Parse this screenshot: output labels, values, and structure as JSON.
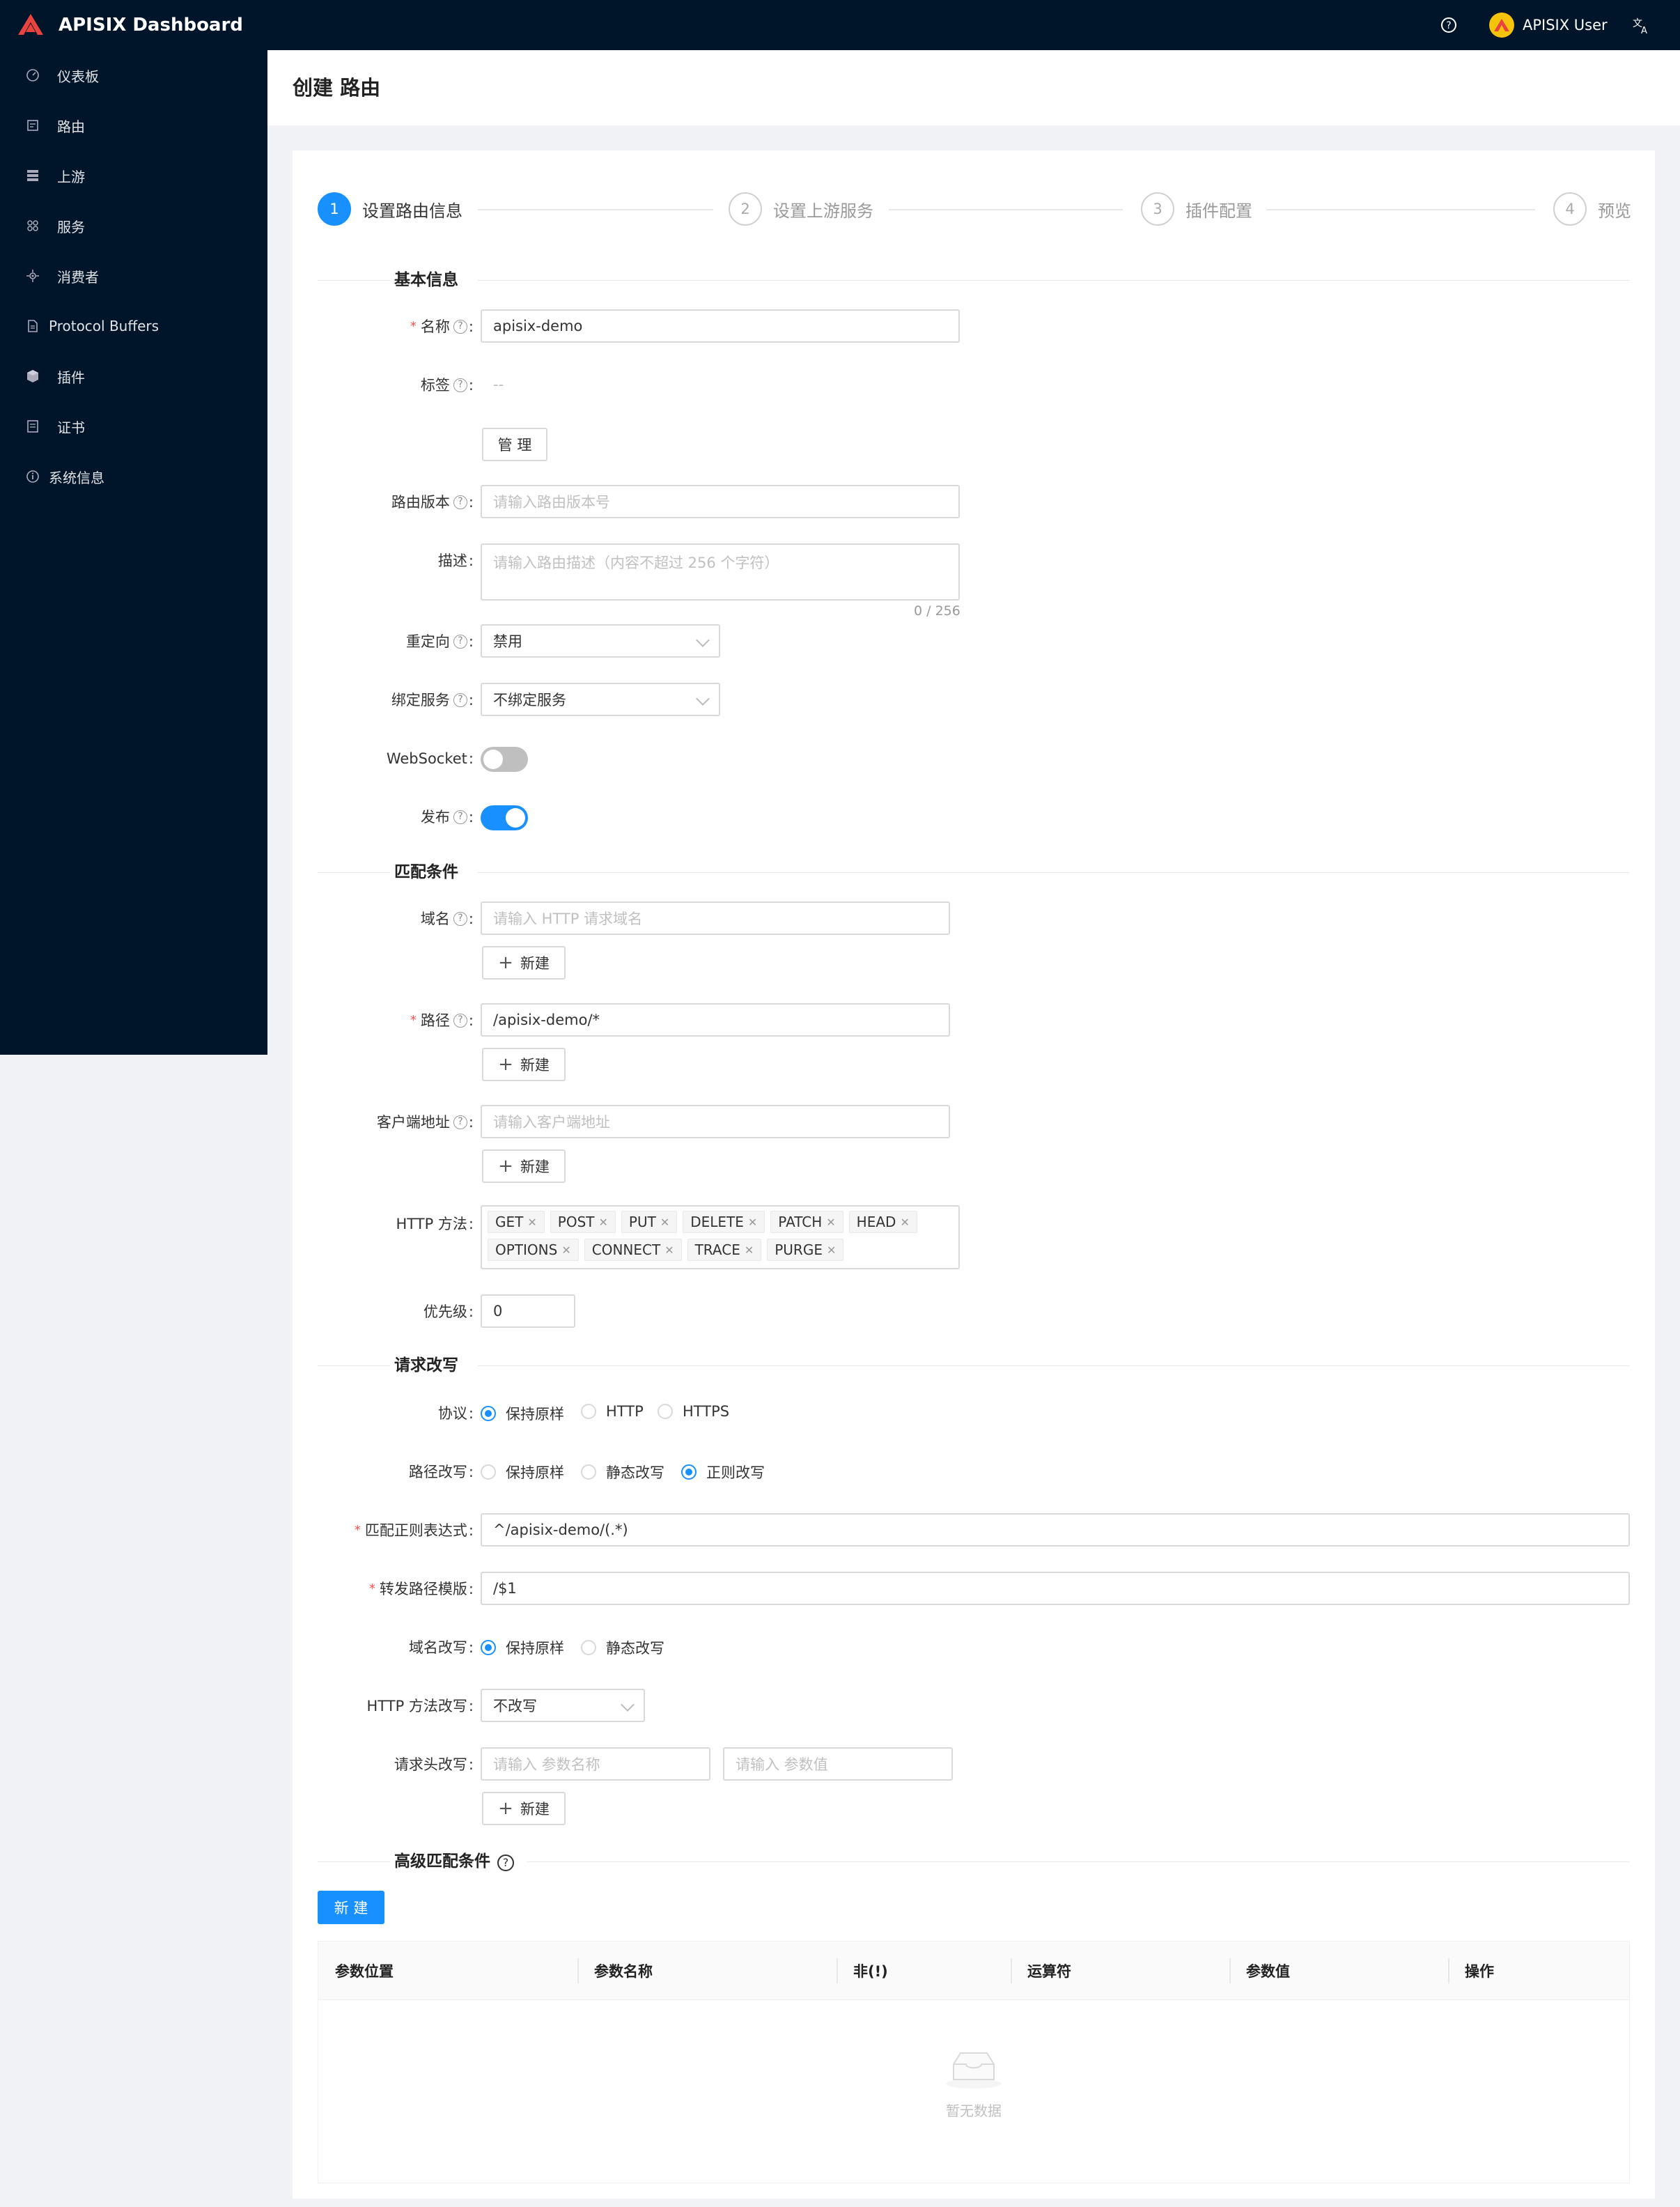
{
  "app": {
    "title": "APISIX Dashboard",
    "user": "APISIX User"
  },
  "sidebar": {
    "items": [
      {
        "label": "仪表板",
        "icon": "dashboard-icon"
      },
      {
        "label": "路由",
        "icon": "route-icon"
      },
      {
        "label": "上游",
        "icon": "database-icon"
      },
      {
        "label": "服务",
        "icon": "cluster-icon"
      },
      {
        "label": "消费者",
        "icon": "team-icon"
      },
      {
        "label": "Protocol Buffers",
        "icon": "file-icon"
      },
      {
        "label": "插件",
        "icon": "plugin-icon"
      },
      {
        "label": "证书",
        "icon": "certificate-icon"
      },
      {
        "label": "系统信息",
        "icon": "info-icon"
      }
    ]
  },
  "page": {
    "title": "创建 路由"
  },
  "steps": [
    {
      "num": "1",
      "title": "设置路由信息",
      "active": true
    },
    {
      "num": "2",
      "title": "设置上游服务",
      "active": false
    },
    {
      "num": "3",
      "title": "插件配置",
      "active": false
    },
    {
      "num": "4",
      "title": "预览",
      "active": false
    }
  ],
  "basic": {
    "section": "基本信息",
    "name_label": "名称",
    "name_value": "apisix-demo",
    "labels_label": "标签",
    "labels_value": "--",
    "manage_btn": "管 理",
    "version_label": "路由版本",
    "version_placeholder": "请输入路由版本号",
    "desc_label": "描述",
    "desc_placeholder": "请输入路由描述（内容不超过 256 个字符）",
    "desc_count": "0 / 256",
    "redirect_label": "重定向",
    "redirect_value": "禁用",
    "service_label": "绑定服务",
    "service_value": "不绑定服务",
    "websocket_label": "WebSocket",
    "websocket_on": false,
    "publish_label": "发布",
    "publish_on": true
  },
  "match": {
    "section": "匹配条件",
    "host_label": "域名",
    "host_placeholder": "请输入 HTTP 请求域名",
    "path_label": "路径",
    "path_value": "/apisix-demo/*",
    "client_label": "客户端地址",
    "client_placeholder": "请输入客户端地址",
    "new_btn": "新建",
    "methods_label": "HTTP 方法",
    "methods_row1": [
      "GET",
      "POST",
      "PUT",
      "DELETE",
      "PATCH",
      "HEAD"
    ],
    "methods_row2": [
      "OPTIONS",
      "CONNECT",
      "TRACE",
      "PURGE"
    ],
    "priority_label": "优先级",
    "priority_value": "0"
  },
  "rewrite": {
    "section": "请求改写",
    "protocol_label": "协议",
    "protocol_options": [
      "保持原样",
      "HTTP",
      "HTTPS"
    ],
    "protocol_selected": 0,
    "path_label": "路径改写",
    "path_options": [
      "保持原样",
      "静态改写",
      "正则改写"
    ],
    "path_selected": 2,
    "regex_label": "匹配正则表达式",
    "regex_value": "^/apisix-demo/(.*)",
    "template_label": "转发路径模版",
    "template_value": "/$1",
    "host_label": "域名改写",
    "host_options": [
      "保持原样",
      "静态改写"
    ],
    "host_selected": 0,
    "method_label": "HTTP 方法改写",
    "method_value": "不改写",
    "header_label": "请求头改写",
    "header_name_placeholder": "请输入 参数名称",
    "header_value_placeholder": "请输入 参数值",
    "new_btn": "新建"
  },
  "advanced": {
    "section": "高级匹配条件",
    "new_btn": "新 建",
    "columns": [
      "参数位置",
      "参数名称",
      "非(!)",
      "运算符",
      "参数值",
      "操作"
    ],
    "empty_text": "暂无数据"
  },
  "colors": {
    "primary": "#1890ff",
    "sidebar": "#001529",
    "required": "#ff4d4f"
  }
}
